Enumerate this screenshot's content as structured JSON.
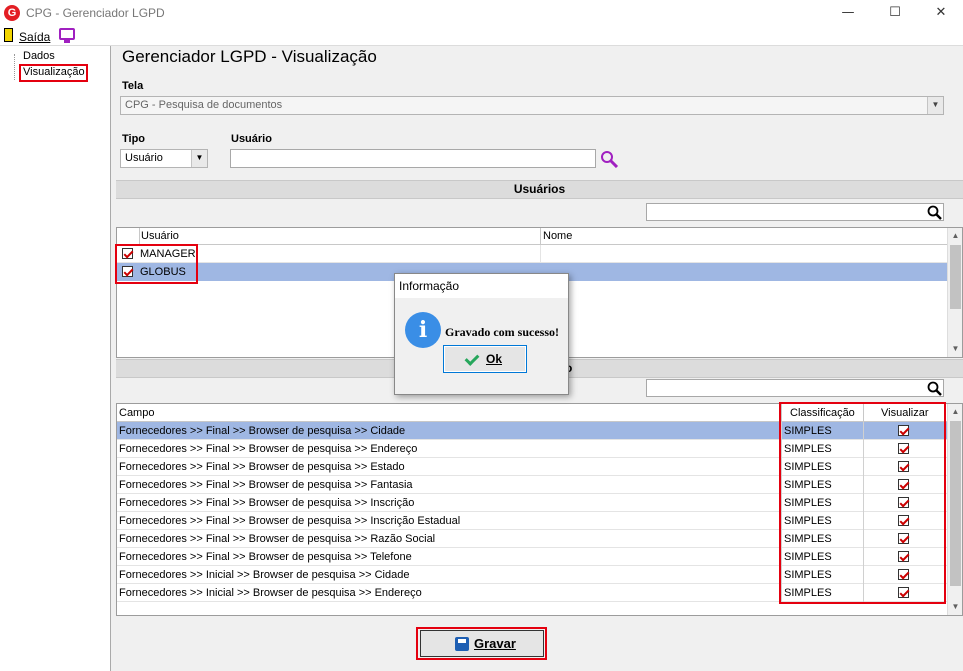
{
  "window": {
    "logo": "G",
    "title": "CPG - Gerenciador LGPD",
    "minimize_glyph": "—",
    "maximize_glyph": "☐",
    "close_glyph": "✕"
  },
  "menu": {
    "exit_label": "Saída"
  },
  "tree": {
    "items": [
      "Dados",
      "Visualização"
    ]
  },
  "page": {
    "title": "Gerenciador LGPD - Visualização"
  },
  "tela": {
    "label": "Tela",
    "value": "CPG - Pesquisa de documentos"
  },
  "tipo": {
    "label": "Tipo",
    "value": "Usuário"
  },
  "usuario_filter": {
    "label": "Usuário",
    "value": ""
  },
  "users_section": {
    "title": "Usuários",
    "columns": [
      "Usuário",
      "Nome"
    ],
    "rows": [
      {
        "user": "MANAGER",
        "name": "",
        "checked": true,
        "selected": false
      },
      {
        "user": "GLOBUS",
        "name": "",
        "checked": true,
        "selected": true
      }
    ]
  },
  "fields_section": {
    "title_visible_fragment": "o",
    "columns": [
      "Campo",
      "Classificação",
      "Visualizar"
    ],
    "rows": [
      {
        "campo": "Fornecedores >> Final >> Browser de pesquisa >> Cidade",
        "classificacao": "SIMPLES",
        "visualizar": true
      },
      {
        "campo": "Fornecedores >> Final >> Browser de pesquisa >> Endereço",
        "classificacao": "SIMPLES",
        "visualizar": true
      },
      {
        "campo": "Fornecedores >> Final >> Browser de pesquisa >> Estado",
        "classificacao": "SIMPLES",
        "visualizar": true
      },
      {
        "campo": "Fornecedores >> Final >> Browser de pesquisa >> Fantasia",
        "classificacao": "SIMPLES",
        "visualizar": true
      },
      {
        "campo": "Fornecedores >> Final >> Browser de pesquisa >> Inscrição",
        "classificacao": "SIMPLES",
        "visualizar": true
      },
      {
        "campo": "Fornecedores >> Final >> Browser de pesquisa >> Inscrição Estadual",
        "classificacao": "SIMPLES",
        "visualizar": true
      },
      {
        "campo": "Fornecedores >> Final >> Browser de pesquisa >> Razão Social",
        "classificacao": "SIMPLES",
        "visualizar": true
      },
      {
        "campo": "Fornecedores >> Final >> Browser de pesquisa >> Telefone",
        "classificacao": "SIMPLES",
        "visualizar": true
      },
      {
        "campo": "Fornecedores >> Inicial >> Browser de pesquisa >> Cidade",
        "classificacao": "SIMPLES",
        "visualizar": true
      },
      {
        "campo": "Fornecedores >> Inicial >> Browser de pesquisa >> Endereço",
        "classificacao": "SIMPLES",
        "visualizar": true
      }
    ]
  },
  "dialog": {
    "title": "Informação",
    "message": "Gravado com sucesso!",
    "ok_label": "Ok",
    "icon_glyph": "i"
  },
  "actions": {
    "save_label": "Gravar"
  },
  "colors": {
    "highlight": "#e4000f",
    "selection": "#9fb7e3",
    "section_header": "#dcdcdc",
    "info_icon": "#3a8ee6",
    "accent_purple": "#a020c0"
  },
  "icons": {
    "app_logo": "app-logo-icon",
    "exit": "exit-door-icon",
    "monitor": "monitor-icon",
    "search": "search-icon",
    "info": "info-icon",
    "check": "check-icon",
    "save": "floppy-disk-icon"
  }
}
